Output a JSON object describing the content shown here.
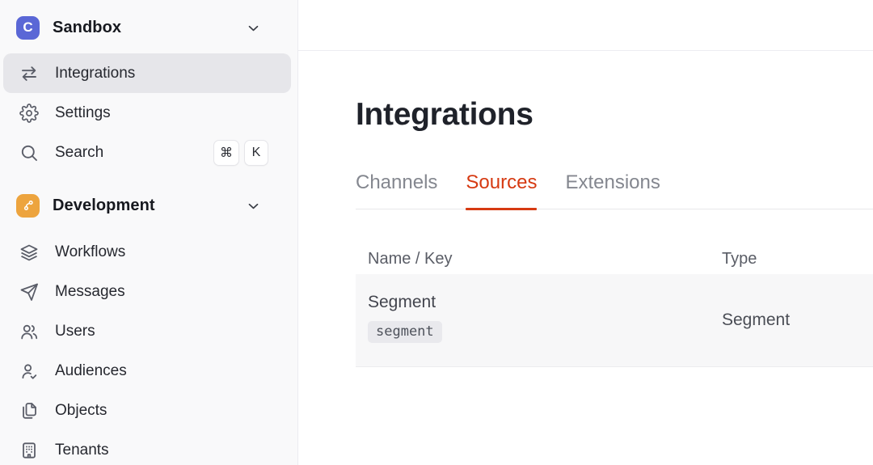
{
  "workspace": {
    "name": "Sandbox",
    "logo_letter": "C"
  },
  "sidebar": {
    "top_items": [
      {
        "label": "Integrations"
      },
      {
        "label": "Settings"
      },
      {
        "label": "Search",
        "shortcut": [
          "⌘",
          "K"
        ]
      }
    ],
    "section": {
      "name": "Development"
    },
    "dev_items": [
      {
        "label": "Workflows"
      },
      {
        "label": "Messages"
      },
      {
        "label": "Users"
      },
      {
        "label": "Audiences"
      },
      {
        "label": "Objects"
      },
      {
        "label": "Tenants"
      }
    ]
  },
  "main": {
    "title": "Integrations",
    "tabs": [
      {
        "label": "Channels"
      },
      {
        "label": "Sources"
      },
      {
        "label": "Extensions"
      }
    ],
    "table": {
      "columns": {
        "name_key": "Name / Key",
        "type": "Type"
      },
      "rows": [
        {
          "name": "Segment",
          "key": "segment",
          "type": "Segment"
        }
      ]
    }
  },
  "colors": {
    "accent_red": "#d63a12",
    "logo_indigo": "#5a67d6",
    "logo_orange": "#eda43e",
    "sidebar_bg": "#f9f9fa",
    "active_item_bg": "#e6e6ea",
    "row_bg": "#f7f7f8"
  }
}
